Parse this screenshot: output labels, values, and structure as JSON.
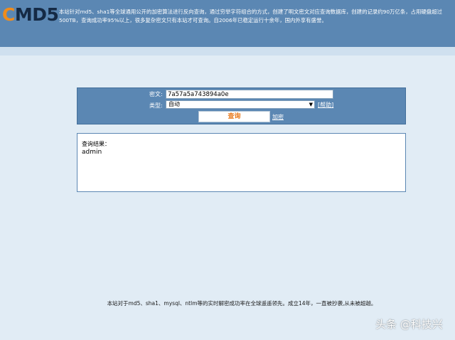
{
  "header": {
    "logo_c": "C",
    "logo_md5": "MD5",
    "description": "本站针对md5、sha1等全球通用公开的加密算法进行反向查询，通过穷举字符组合的方式，创建了明文密文对应查询数据库，创建的记录约90万亿条，占用硬盘超过500TB，查询成功率95%以上，很多复杂密文只有本站才可查询。自2006年已稳定运行十余年，国内外享有盛誉。"
  },
  "query": {
    "cipher_label": "密文:",
    "cipher_value": "7a57a5a743894a0e",
    "type_label": "类型:",
    "type_value": "自动",
    "help_link": "[帮助]",
    "search_button": "查询",
    "encrypt_link": "加密"
  },
  "result": {
    "title": "查询结果：",
    "value": "admin"
  },
  "footer": {
    "text": "本站对于md5、sha1、mysql、ntlm等的实时解密成功率在全球遥遥领先。成立14年，一直被抄袭,从未被超越。"
  },
  "watermark": "头条 @科技兴",
  "colors": {
    "header_bg": "#5b87b3",
    "logo_accent": "#f08c1c",
    "logo_dark": "#152a45",
    "page_bg": "#e1ecf5",
    "search_button_text": "#e8791c"
  }
}
